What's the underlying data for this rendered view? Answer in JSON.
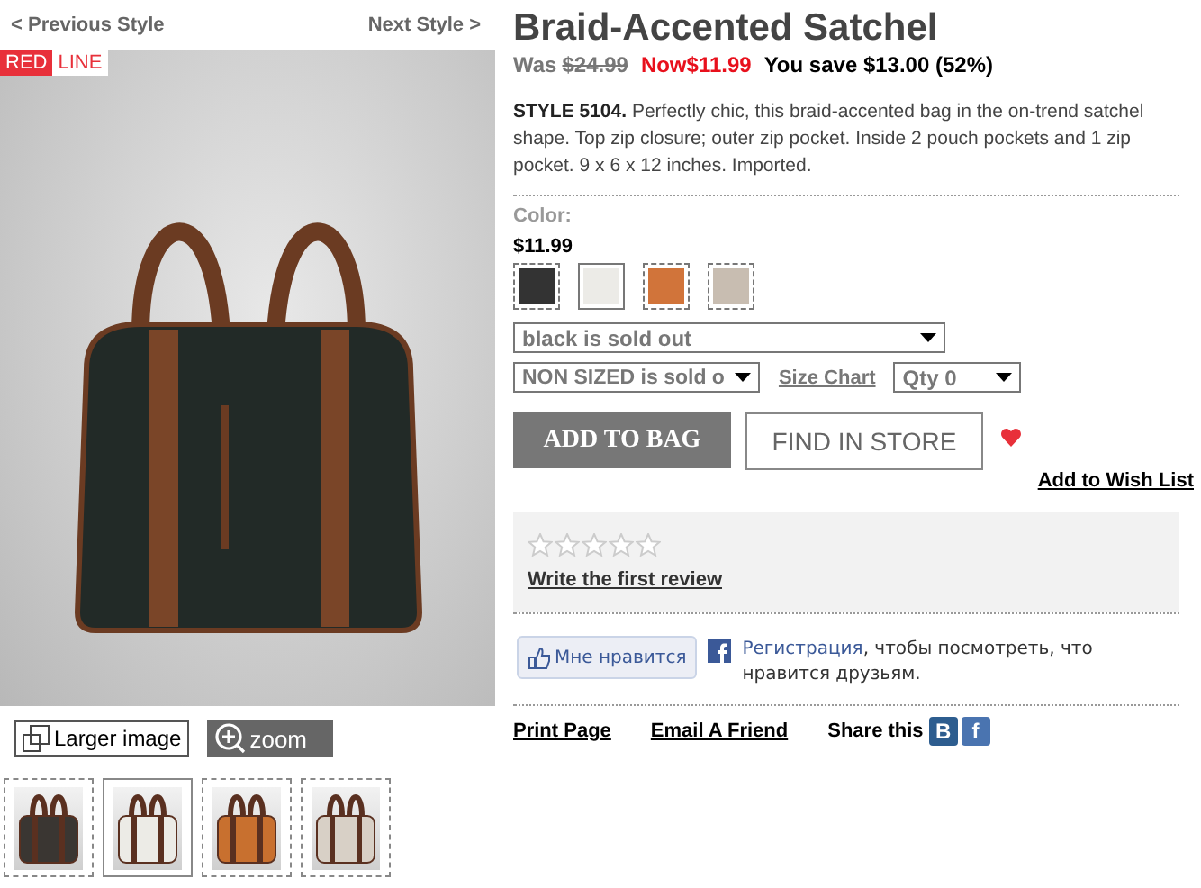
{
  "nav": {
    "previous": "< Previous Style",
    "next": "Next Style >"
  },
  "badge": {
    "left": "RED",
    "right": "LINE"
  },
  "image_tools": {
    "larger": "Larger image",
    "zoom": "zoom"
  },
  "thumbnails": [
    {
      "color": "#3a3632",
      "selected": false
    },
    {
      "color": "#ecebe6",
      "selected": true
    },
    {
      "color": "#c8702f",
      "selected": false
    },
    {
      "color": "#d8d0c6",
      "selected": false
    }
  ],
  "product": {
    "title": "Braid-Accented Satchel",
    "was_label": "Was",
    "was_price": "$24.99",
    "now_price": "Now$11.99",
    "savings": "You save $13.00 (52%)",
    "description": "**STYLE  5104.** Perfectly chic, this braid-accented bag in the on-trend satchel shape. Top zip closure; outer zip pocket. Inside 2 pouch pockets and 1 zip pocket. 9 x 6 x 12 inches. Imported."
  },
  "color_label": "Color:",
  "swatch_price": "$11.99",
  "swatches": [
    {
      "color": "#333333",
      "selected": false
    },
    {
      "color": "#ecebe7",
      "selected": true
    },
    {
      "color": "#d1743a",
      "selected": false
    },
    {
      "color": "#c8bdb1",
      "selected": false
    }
  ],
  "color_select": {
    "value": "black is sold out"
  },
  "size_select": {
    "value": "NON SIZED is sold o"
  },
  "size_chart": "Size Chart",
  "qty_select": {
    "value": "Qty 0"
  },
  "buttons": {
    "add": "ADD TO BAG",
    "find": "FIND IN STORE"
  },
  "wish_list": "Add to Wish List",
  "reviews": {
    "stars": 0,
    "link": "Write the first review"
  },
  "like": {
    "button": "Мне нравится",
    "link": "Регистрация",
    "text": ", чтобы посмотреть, что нравится друзьям."
  },
  "footer": {
    "print": "Print Page",
    "email": "Email A Friend",
    "share": "Share this",
    "share_icons": [
      {
        "kind": "vk",
        "glyph": "B"
      },
      {
        "kind": "facebook",
        "glyph": "f"
      }
    ]
  }
}
